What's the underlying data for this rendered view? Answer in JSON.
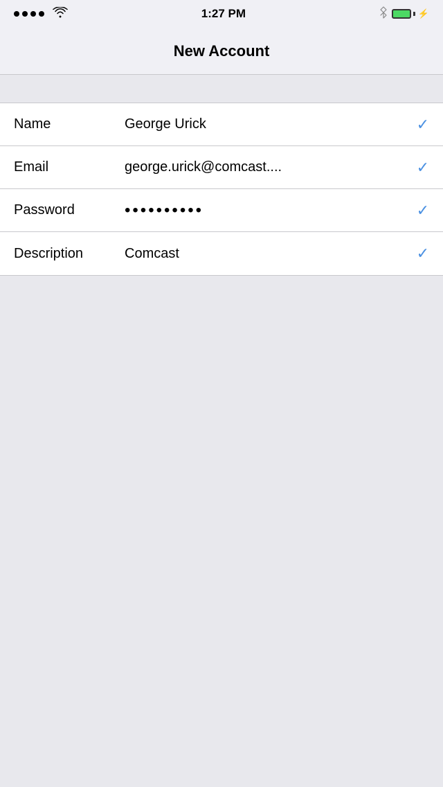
{
  "statusBar": {
    "time": "1:27 PM",
    "signalDots": 4,
    "hasWifi": true,
    "hasBluetooth": true,
    "batteryColor": "#4cd964"
  },
  "navBar": {
    "title": "New Account"
  },
  "form": {
    "rows": [
      {
        "label": "Name",
        "value": "George Urick",
        "isPassword": false,
        "hasCheck": true
      },
      {
        "label": "Email",
        "value": "george.urick@comcast....",
        "isPassword": false,
        "hasCheck": true
      },
      {
        "label": "Password",
        "value": "••••••••••",
        "isPassword": true,
        "hasCheck": true
      },
      {
        "label": "Description",
        "value": "Comcast",
        "isPassword": false,
        "hasCheck": true
      }
    ]
  },
  "icons": {
    "checkmark": "✓",
    "bluetooth": "✱"
  }
}
